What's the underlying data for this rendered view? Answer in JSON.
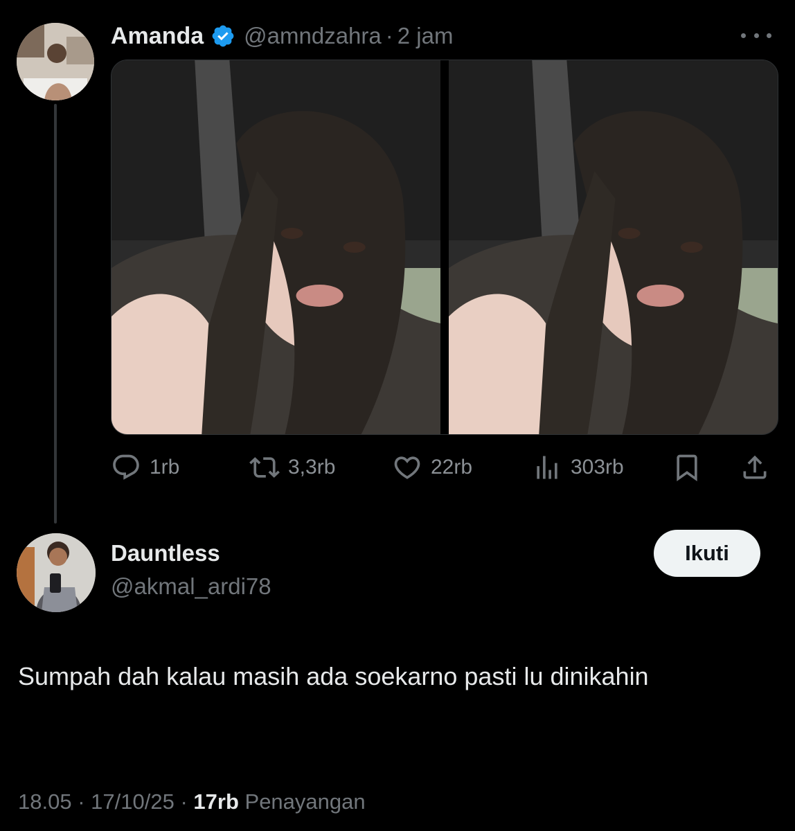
{
  "parent_tweet": {
    "author_name": "Amanda",
    "handle": "@amndzahra",
    "separator": "·",
    "time": "2 jam",
    "verified": true,
    "avatar_icon": "user-avatar-photo",
    "more_icon": "ellipsis-icon",
    "media_count": 2,
    "actions": {
      "replies": "1rb",
      "reposts": "3,3rb",
      "likes": "22rb",
      "views": "303rb"
    }
  },
  "reply": {
    "author_name": "Dauntless",
    "handle": "@akmal_ardi78",
    "follow_label": "Ikuti",
    "text": "Sumpah dah kalau masih ada soekarno pasti lu dinikahin",
    "time": "18.05",
    "date": "17/10/25",
    "separator": "·",
    "views_count": "17rb",
    "views_label": "Penayangan"
  },
  "colors": {
    "background": "#000000",
    "text_primary": "#e7e9ea",
    "text_muted": "#71767b",
    "verified_blue": "#1d9bf0",
    "follow_button_bg": "#eff3f4"
  }
}
